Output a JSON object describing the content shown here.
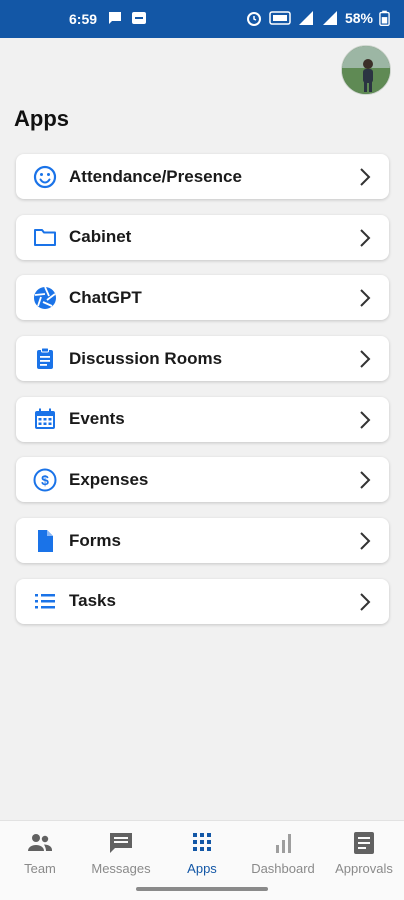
{
  "status_bar": {
    "time": "6:59",
    "battery": "58%",
    "network": "4G"
  },
  "header": {
    "title": "Apps"
  },
  "apps": [
    {
      "label": "Attendance/Presence",
      "icon": "smiley-icon"
    },
    {
      "label": "Cabinet",
      "icon": "folder-icon"
    },
    {
      "label": "ChatGPT",
      "icon": "aperture-icon"
    },
    {
      "label": "Discussion Rooms",
      "icon": "clipboard-icon"
    },
    {
      "label": "Events",
      "icon": "calendar-icon"
    },
    {
      "label": "Expenses",
      "icon": "dollar-icon"
    },
    {
      "label": "Forms",
      "icon": "document-icon"
    },
    {
      "label": "Tasks",
      "icon": "list-icon"
    }
  ],
  "bottom_nav": [
    {
      "label": "Team",
      "icon": "team-icon",
      "active": false
    },
    {
      "label": "Messages",
      "icon": "message-icon",
      "active": false
    },
    {
      "label": "Apps",
      "icon": "apps-grid-icon",
      "active": true
    },
    {
      "label": "Dashboard",
      "icon": "bar-chart-icon",
      "active": false
    },
    {
      "label": "Approvals",
      "icon": "approvals-icon",
      "active": false
    }
  ],
  "colors": {
    "brand": "#1357a6",
    "icon_blue": "#1a73e8",
    "background": "#f1f1f1",
    "inactive": "#8a8a8a"
  }
}
